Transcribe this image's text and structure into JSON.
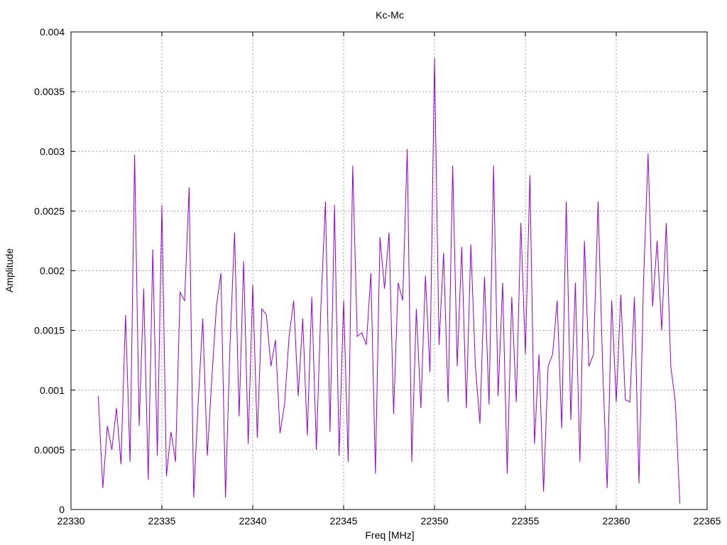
{
  "chart_data": {
    "type": "line",
    "title": "Kc-Mc",
    "xlabel": "Freq [MHz]",
    "ylabel": "Amplitude",
    "xlim": [
      22330,
      22365
    ],
    "ylim": [
      0,
      0.004
    ],
    "x_ticks": [
      22330,
      22335,
      22340,
      22345,
      22350,
      22355,
      22360,
      22365
    ],
    "x_tick_labels": [
      "22330",
      "22335",
      "22340",
      "22345",
      "22350",
      "22355",
      "22360",
      "22365"
    ],
    "y_ticks": [
      0,
      0.0005,
      0.001,
      0.0015,
      0.002,
      0.0025,
      0.003,
      0.0035,
      0.004
    ],
    "y_tick_labels": [
      "0",
      "0.0005",
      "0.001",
      "0.0015",
      "0.002",
      "0.0025",
      "0.003",
      "0.0035",
      "0.004"
    ],
    "grid": true,
    "legend": "none",
    "line_color": "#9400d3",
    "series": [
      {
        "x": [
          22331.5,
          22331.75,
          22332.0,
          22332.25,
          22332.5,
          22332.75,
          22333.0,
          22333.25,
          22333.5,
          22333.75,
          22334.0,
          22334.25,
          22334.5,
          22334.75,
          22335.0,
          22335.25,
          22335.5,
          22335.75,
          22336.0,
          22336.25,
          22336.5,
          22336.75,
          22337.0,
          22337.25,
          22337.5,
          22337.75,
          22338.0,
          22338.25,
          22338.5,
          22338.75,
          22339.0,
          22339.25,
          22339.5,
          22339.75,
          22340.0,
          22340.25,
          22340.5,
          22340.75,
          22341.0,
          22341.25,
          22341.5,
          22341.75,
          22342.0,
          22342.25,
          22342.5,
          22342.75,
          22343.0,
          22343.25,
          22343.5,
          22343.75,
          22344.0,
          22344.25,
          22344.5,
          22344.75,
          22345.0,
          22345.25,
          22345.5,
          22345.75,
          22346.0,
          22346.25,
          22346.5,
          22346.75,
          22347.0,
          22347.25,
          22347.5,
          22347.75,
          22348.0,
          22348.25,
          22348.5,
          22348.75,
          22349.0,
          22349.25,
          22349.5,
          22349.75,
          22350.0,
          22350.25,
          22350.5,
          22350.75,
          22351.0,
          22351.25,
          22351.5,
          22351.75,
          22352.0,
          22352.25,
          22352.5,
          22352.75,
          22353.0,
          22353.25,
          22353.5,
          22353.75,
          22354.0,
          22354.25,
          22354.5,
          22354.75,
          22355.0,
          22355.25,
          22355.5,
          22355.75,
          22356.0,
          22356.25,
          22356.5,
          22356.75,
          22357.0,
          22357.25,
          22357.5,
          22357.75,
          22358.0,
          22358.25,
          22358.5,
          22358.75,
          22359.0,
          22359.25,
          22359.5,
          22359.75,
          22360.0,
          22360.25,
          22360.5,
          22360.75,
          22361.0,
          22361.25,
          22361.5,
          22361.75,
          22362.0,
          22362.25,
          22362.5,
          22362.75,
          22363.0,
          22363.25,
          22363.5
        ],
        "values": [
          0.00095,
          0.00018,
          0.0007,
          0.0005,
          0.00085,
          0.00038,
          0.00163,
          0.0004,
          0.00297,
          0.0007,
          0.00185,
          0.00025,
          0.00218,
          0.00045,
          0.00255,
          0.00028,
          0.00065,
          0.0004,
          0.00182,
          0.00175,
          0.0027,
          0.0001,
          0.0009,
          0.0016,
          0.00045,
          0.0011,
          0.0017,
          0.00198,
          0.0001,
          0.00138,
          0.00232,
          0.00078,
          0.00208,
          0.00055,
          0.00188,
          0.0006,
          0.00168,
          0.00163,
          0.0012,
          0.00142,
          0.00064,
          0.00088,
          0.00145,
          0.00175,
          0.00095,
          0.0016,
          0.00062,
          0.00178,
          0.0005,
          0.0017,
          0.00258,
          0.00065,
          0.00255,
          0.00045,
          0.00175,
          0.0004,
          0.00288,
          0.00145,
          0.00148,
          0.00138,
          0.00198,
          0.0003,
          0.00228,
          0.00185,
          0.00232,
          0.0008,
          0.0019,
          0.00175,
          0.00302,
          0.0004,
          0.00168,
          0.00085,
          0.00196,
          0.00115,
          0.00378,
          0.00138,
          0.00215,
          0.0009,
          0.00288,
          0.0012,
          0.0022,
          0.00085,
          0.00222,
          0.0012,
          0.00072,
          0.00195,
          0.00088,
          0.00288,
          0.00095,
          0.0019,
          0.0003,
          0.00178,
          0.0009,
          0.0024,
          0.0013,
          0.0028,
          0.00055,
          0.0013,
          0.00015,
          0.0012,
          0.0013,
          0.00175,
          0.00068,
          0.00258,
          0.00075,
          0.0019,
          0.0004,
          0.00225,
          0.0012,
          0.0013,
          0.00258,
          0.0012,
          0.00018,
          0.00175,
          0.0009,
          0.0018,
          0.00092,
          0.0009,
          0.00178,
          0.00022,
          0.0019,
          0.00298,
          0.0017,
          0.00225,
          0.0015,
          0.0024,
          0.0012,
          0.0009,
          5e-05
        ]
      }
    ]
  }
}
